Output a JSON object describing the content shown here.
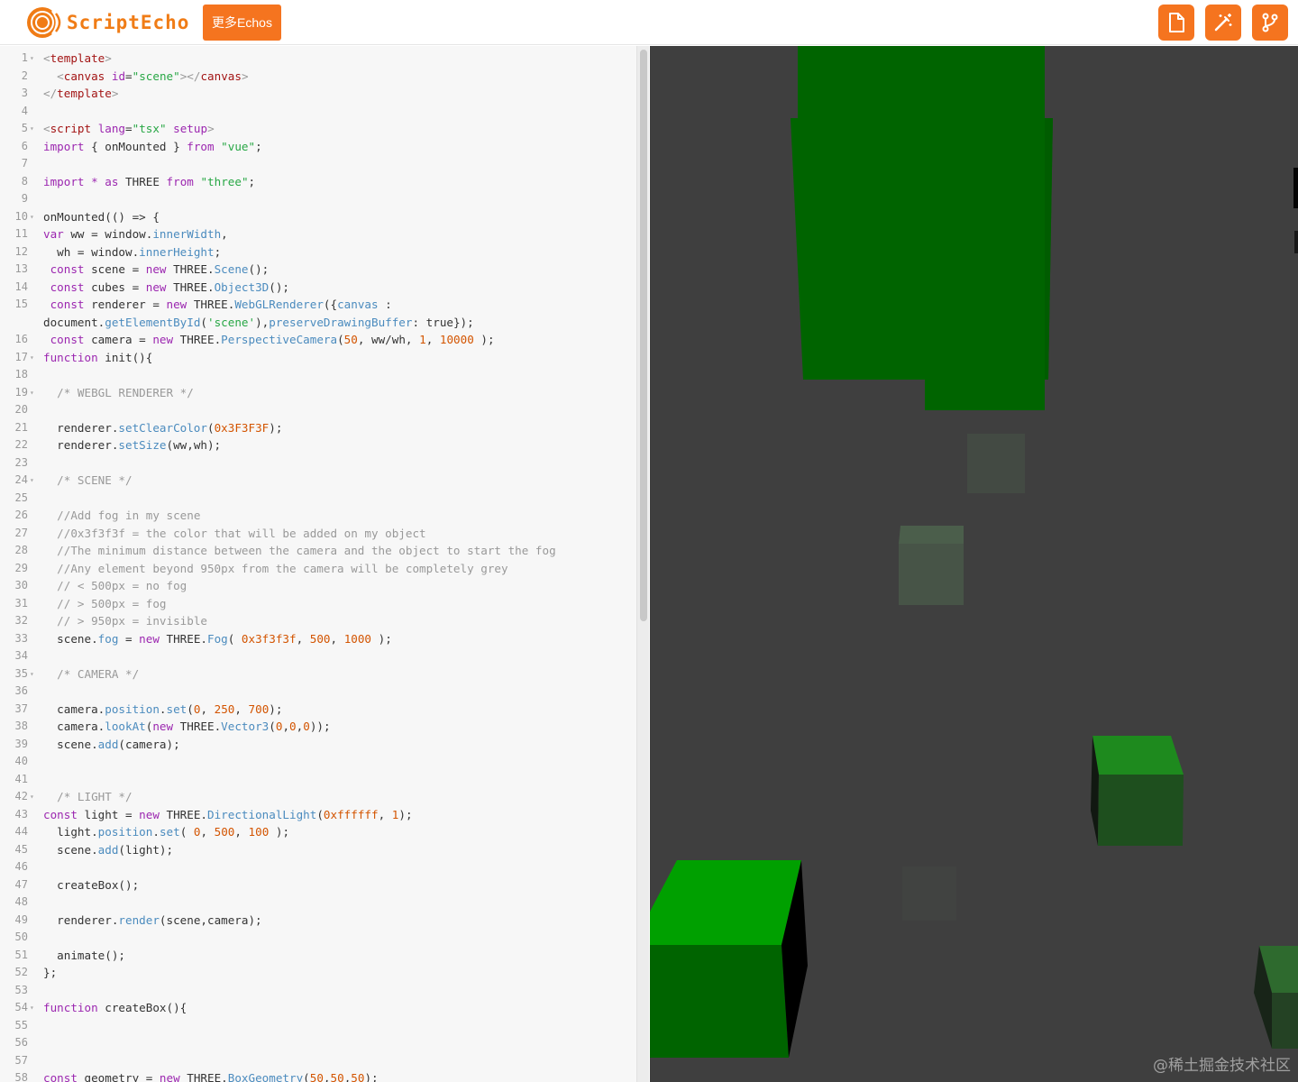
{
  "header": {
    "logo_text": "ScriptEcho",
    "more_button": "更多Echos",
    "tools": [
      {
        "icon": "file-icon",
        "name": "new-file-button"
      },
      {
        "icon": "magic-wand-icon",
        "name": "magic-button"
      },
      {
        "icon": "git-branch-icon",
        "name": "fork-button"
      }
    ]
  },
  "colors": {
    "accent": "#f5741f",
    "scene_background": "#3f3f3f",
    "cube_green": "#00a000"
  },
  "editor": {
    "lines": [
      {
        "n": "1",
        "fold": true,
        "html": "<span class='br'>&lt;</span><span class='tg'>template</span><span class='br'>&gt;</span>"
      },
      {
        "n": "2",
        "html": "  <span class='br'>&lt;</span><span class='tg'>canvas</span> <span class='at'>id</span>=<span class='st'>\"scene\"</span><span class='br'>&gt;&lt;/</span><span class='tg'>canvas</span><span class='br'>&gt;</span>"
      },
      {
        "n": "3",
        "html": "<span class='br'>&lt;/</span><span class='tg'>template</span><span class='br'>&gt;</span>"
      },
      {
        "n": "4",
        "html": ""
      },
      {
        "n": "5",
        "fold": true,
        "html": "<span class='br'>&lt;</span><span class='tg'>script</span> <span class='at'>lang</span>=<span class='st'>\"tsx\"</span> <span class='at'>setup</span><span class='br'>&gt;</span>"
      },
      {
        "n": "6",
        "html": "<span class='kw'>import</span> { onMounted } <span class='kw'>from</span> <span class='st'>\"vue\"</span>;"
      },
      {
        "n": "7",
        "html": ""
      },
      {
        "n": "8",
        "html": "<span class='kw'>import</span> <span class='kw'>*</span> <span class='kw'>as</span> THREE <span class='kw'>from</span> <span class='st'>\"three\"</span>;"
      },
      {
        "n": "9",
        "html": ""
      },
      {
        "n": "10",
        "fold": true,
        "html": "onMounted(() =&gt; {"
      },
      {
        "n": "11",
        "html": "<span class='kw'>var</span> ww = window.<span class='pr'>innerWidth</span>,"
      },
      {
        "n": "12",
        "html": "  wh = window.<span class='pr'>innerHeight</span>;"
      },
      {
        "n": "13",
        "html": " <span class='kw'>const</span> scene = <span class='kw'>new</span> THREE.<span class='pr'>Scene</span>();"
      },
      {
        "n": "14",
        "html": " <span class='kw'>const</span> cubes = <span class='kw'>new</span> THREE.<span class='pr'>Object3D</span>();"
      },
      {
        "n": "15",
        "html": " <span class='kw'>const</span> renderer = <span class='kw'>new</span> THREE.<span class='pr'>WebGLRenderer</span>({<span class='pr'>canvas</span> :"
      },
      {
        "n": "",
        "html": "document.<span class='pr'>getElementById</span>(<span class='st'>'scene'</span>),<span class='pr'>preserveDrawingBuffer</span>: true});"
      },
      {
        "n": "16",
        "html": " <span class='kw'>const</span> camera = <span class='kw'>new</span> THREE.<span class='pr'>PerspectiveCamera</span>(<span class='nm'>50</span>, ww/wh, <span class='nm'>1</span>, <span class='nm'>10000</span> );"
      },
      {
        "n": "17",
        "fold": true,
        "html": "<span class='kw'>function</span> init(){"
      },
      {
        "n": "18",
        "html": ""
      },
      {
        "n": "19",
        "fold": true,
        "html": "  <span class='cm'>/* WEBGL RENDERER */</span>"
      },
      {
        "n": "20",
        "html": ""
      },
      {
        "n": "21",
        "html": "  renderer.<span class='pr'>setClearColor</span>(<span class='nm'>0x3F3F3F</span>);"
      },
      {
        "n": "22",
        "html": "  renderer.<span class='pr'>setSize</span>(ww,wh);"
      },
      {
        "n": "23",
        "html": ""
      },
      {
        "n": "24",
        "fold": true,
        "html": "  <span class='cm'>/* SCENE */</span>"
      },
      {
        "n": "25",
        "html": ""
      },
      {
        "n": "26",
        "html": "  <span class='cm'>//Add fog in my scene</span>"
      },
      {
        "n": "27",
        "html": "  <span class='cm'>//0x3f3f3f = the color that will be added on my object</span>"
      },
      {
        "n": "28",
        "html": "  <span class='cm'>//The minimum distance between the camera and the object to start the fog</span>"
      },
      {
        "n": "29",
        "html": "  <span class='cm'>//Any element beyond 950px from the camera will be completely grey</span>"
      },
      {
        "n": "30",
        "html": "  <span class='cm'>// &lt; 500px = no fog</span>"
      },
      {
        "n": "31",
        "html": "  <span class='cm'>// &gt; 500px = fog</span>"
      },
      {
        "n": "32",
        "html": "  <span class='cm'>// &gt; 950px = invisible</span>"
      },
      {
        "n": "33",
        "html": "  scene.<span class='pr'>fog</span> = <span class='kw'>new</span> THREE.<span class='pr'>Fog</span>( <span class='nm'>0x3f3f3f</span>, <span class='nm'>500</span>, <span class='nm'>1000</span> );"
      },
      {
        "n": "34",
        "html": ""
      },
      {
        "n": "35",
        "fold": true,
        "html": "  <span class='cm'>/* CAMERA */</span>"
      },
      {
        "n": "36",
        "html": ""
      },
      {
        "n": "37",
        "html": "  camera.<span class='pr'>position</span>.<span class='pr'>set</span>(<span class='nm'>0</span>, <span class='nm'>250</span>, <span class='nm'>700</span>);"
      },
      {
        "n": "38",
        "html": "  camera.<span class='pr'>lookAt</span>(<span class='kw'>new</span> THREE.<span class='pr'>Vector3</span>(<span class='nm'>0</span>,<span class='nm'>0</span>,<span class='nm'>0</span>));"
      },
      {
        "n": "39",
        "html": "  scene.<span class='pr'>add</span>(camera);"
      },
      {
        "n": "40",
        "html": ""
      },
      {
        "n": "41",
        "html": ""
      },
      {
        "n": "42",
        "fold": true,
        "html": "  <span class='cm'>/* LIGHT */</span>"
      },
      {
        "n": "43",
        "html": "<span class='kw'>const</span> light = <span class='kw'>new</span> THREE.<span class='pr'>DirectionalLight</span>(<span class='nm'>0xffffff</span>, <span class='nm'>1</span>);"
      },
      {
        "n": "44",
        "html": "  light.<span class='pr'>position</span>.<span class='pr'>set</span>( <span class='nm'>0</span>, <span class='nm'>500</span>, <span class='nm'>100</span> );"
      },
      {
        "n": "45",
        "html": "  scene.<span class='pr'>add</span>(light);"
      },
      {
        "n": "46",
        "html": ""
      },
      {
        "n": "47",
        "html": "  createBox();"
      },
      {
        "n": "48",
        "html": ""
      },
      {
        "n": "49",
        "html": "  renderer.<span class='pr'>render</span>(scene,camera);"
      },
      {
        "n": "50",
        "html": ""
      },
      {
        "n": "51",
        "html": "  animate();"
      },
      {
        "n": "52",
        "html": "};"
      },
      {
        "n": "53",
        "html": ""
      },
      {
        "n": "54",
        "fold": true,
        "html": "<span class='kw'>function</span> createBox(){"
      },
      {
        "n": "55",
        "html": ""
      },
      {
        "n": "56",
        "html": ""
      },
      {
        "n": "57",
        "html": ""
      },
      {
        "n": "58",
        "html": "<span class='kw'>const</span> geometry = <span class='kw'>new</span> THREE.<span class='pr'>BoxGeometry</span>(<span class='nm'>50</span>,<span class='nm'>50</span>,<span class='nm'>50</span>);"
      }
    ]
  },
  "watermark": "@稀土掘金技术社区"
}
